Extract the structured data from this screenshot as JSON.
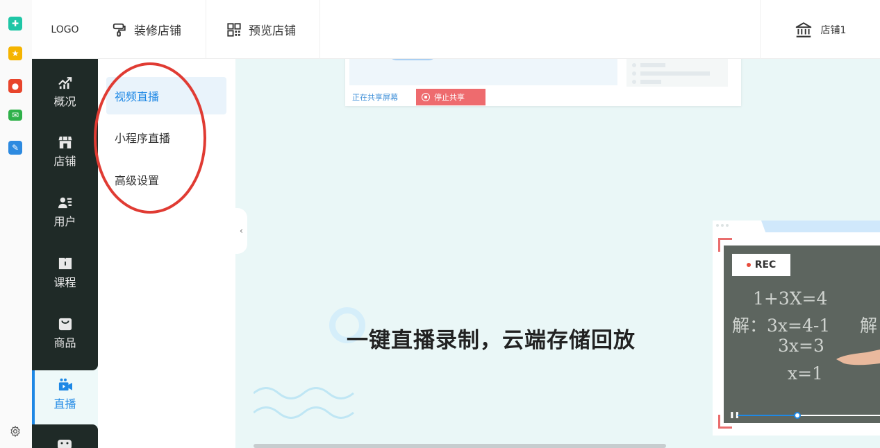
{
  "header": {
    "logo": "LOGO",
    "nav": [
      {
        "label": "装修店铺",
        "icon": "paint-roller-icon"
      },
      {
        "label": "预览店铺",
        "icon": "qr-code-icon"
      }
    ],
    "shop": {
      "label": "店铺1",
      "icon": "bank-building-icon"
    }
  },
  "sidebar": {
    "items": [
      {
        "label": "概况",
        "icon": "trend-chart-icon"
      },
      {
        "label": "店铺",
        "icon": "storefront-icon"
      },
      {
        "label": "用户",
        "icon": "users-icon"
      },
      {
        "label": "课程",
        "icon": "book-icon"
      },
      {
        "label": "商品",
        "icon": "shopping-bag-icon"
      },
      {
        "label": "直播",
        "icon": "video-camera-icon",
        "active": true
      }
    ]
  },
  "submenu": {
    "items": [
      {
        "label": "视频直播",
        "active": true
      },
      {
        "label": "小程序直播"
      },
      {
        "label": "高级设置"
      }
    ]
  },
  "main": {
    "share_status": "正在共享屏幕",
    "stop_share": "停止共享",
    "headline": "一键直播录制，云端存储回放",
    "rec_label": "REC",
    "chalk_lines": [
      "1+3X=4",
      "解：3x=4-1",
      "3x=3",
      "x=1",
      "解"
    ],
    "video_progress": 0.42
  },
  "colors": {
    "accent": "#1e88e5",
    "sidebar_bg": "#1f2a27",
    "annotation_red": "#e03b33",
    "stop_btn": "#ee6b6e"
  }
}
